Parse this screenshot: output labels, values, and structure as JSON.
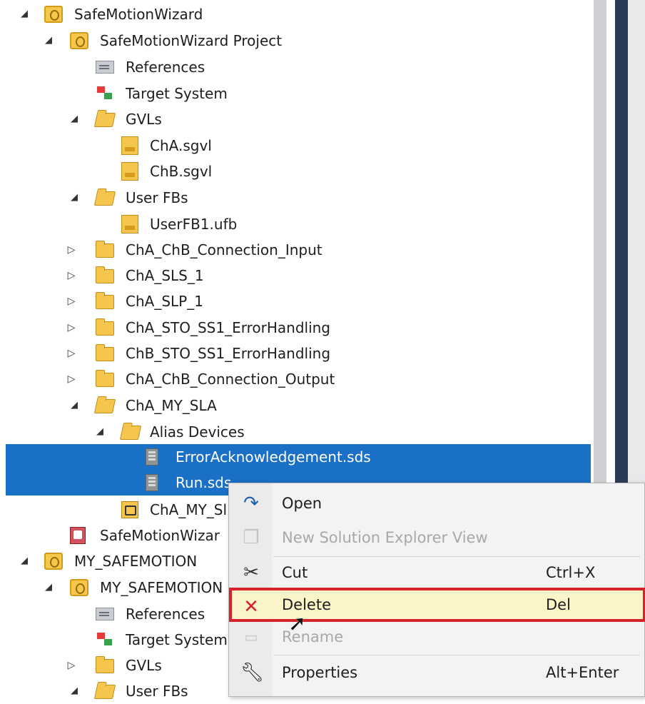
{
  "tree": {
    "items": [
      {
        "label": "SafeMotionWizard",
        "icon": "solution-icon",
        "state": "expanded"
      },
      {
        "label": "SafeMotionWizard Project",
        "icon": "project-icon",
        "state": "expanded"
      },
      {
        "label": "References",
        "icon": "references-icon",
        "state": "none"
      },
      {
        "label": "Target System",
        "icon": "target-system-icon",
        "state": "none"
      },
      {
        "label": "GVLs",
        "icon": "folder-open-icon",
        "state": "expanded"
      },
      {
        "label": "ChA.sgvl",
        "icon": "gvl-file-icon",
        "state": "none"
      },
      {
        "label": "ChB.sgvl",
        "icon": "gvl-file-icon",
        "state": "none"
      },
      {
        "label": "User FBs",
        "icon": "folder-open-icon",
        "state": "expanded"
      },
      {
        "label": "UserFB1.ufb",
        "icon": "ufb-file-icon",
        "state": "none"
      },
      {
        "label": "ChA_ChB_Connection_Input",
        "icon": "folder-icon",
        "state": "collapsed"
      },
      {
        "label": "ChA_SLS_1",
        "icon": "folder-icon",
        "state": "collapsed"
      },
      {
        "label": "ChA_SLP_1",
        "icon": "folder-icon",
        "state": "collapsed"
      },
      {
        "label": "ChA_STO_SS1_ErrorHandling",
        "icon": "folder-icon",
        "state": "collapsed"
      },
      {
        "label": "ChB_STO_SS1_ErrorHandling",
        "icon": "folder-icon",
        "state": "collapsed"
      },
      {
        "label": "ChA_ChB_Connection_Output",
        "icon": "folder-icon",
        "state": "collapsed"
      },
      {
        "label": "ChA_MY_SLA",
        "icon": "folder-open-icon",
        "state": "expanded"
      },
      {
        "label": "Alias Devices",
        "icon": "folder-open-icon",
        "state": "expanded"
      },
      {
        "label": "ErrorAcknowledgement.sds",
        "icon": "sds-file-icon",
        "state": "none"
      },
      {
        "label": "Run.sds",
        "icon": "sds-file-icon",
        "state": "none"
      },
      {
        "label": "ChA_MY_Sl",
        "icon": "mapping-icon",
        "state": "none"
      },
      {
        "label": "SafeMotionWizar",
        "icon": "safety-project-icon",
        "state": "none"
      },
      {
        "label": "MY_SAFEMOTION",
        "icon": "solution-icon",
        "state": "expanded"
      },
      {
        "label": "MY_SAFEMOTION",
        "icon": "project-icon",
        "state": "expanded"
      },
      {
        "label": "References",
        "icon": "references-icon",
        "state": "none"
      },
      {
        "label": "Target System",
        "icon": "target-system-icon",
        "state": "none"
      },
      {
        "label": "GVLs",
        "icon": "folder-icon",
        "state": "collapsed"
      },
      {
        "label": "User FBs",
        "icon": "folder-open-icon",
        "state": "expanded"
      }
    ]
  },
  "context_menu": {
    "items": [
      {
        "label": "Open",
        "shortcut": "",
        "icon": "open-icon",
        "enabled": true
      },
      {
        "label": "New Solution Explorer View",
        "shortcut": "",
        "icon": "new-view-icon",
        "enabled": false
      },
      {
        "label": "Cut",
        "shortcut": "Ctrl+X",
        "icon": "cut-icon",
        "enabled": true
      },
      {
        "label": "Delete",
        "shortcut": "Del",
        "icon": "delete-icon",
        "enabled": true
      },
      {
        "label": "Rename",
        "shortcut": "",
        "icon": "rename-icon",
        "enabled": false
      },
      {
        "label": "Properties",
        "shortcut": "Alt+Enter",
        "icon": "properties-icon",
        "enabled": true
      }
    ]
  },
  "colors": {
    "selection": "#1a6fc7",
    "highlight_border": "#d6222a",
    "hover_fill": "#fbf4c8"
  }
}
